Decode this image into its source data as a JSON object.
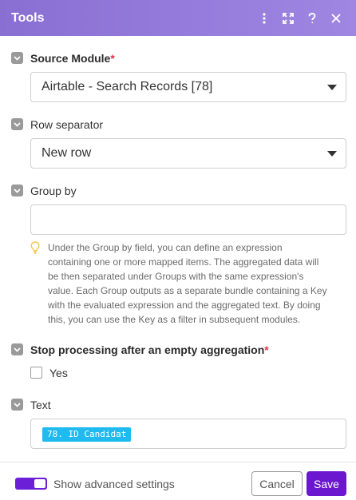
{
  "header": {
    "title": "Tools",
    "icons": [
      "more-vertical-icon",
      "expand-icon",
      "help-icon",
      "close-icon"
    ]
  },
  "fields": {
    "source_module": {
      "label": "Source Module",
      "required_mark": "*",
      "value": "Airtable - Search Records [78]"
    },
    "row_separator": {
      "label": "Row separator",
      "value": "New row"
    },
    "group_by": {
      "label": "Group by",
      "value": "",
      "hint_lines": [
        "Under the Group by field, you can define an expression",
        "containing one or more mapped items. The aggregated data will",
        "be then separated under Groups with the same expression's",
        "value. Each Group outputs as a separate bundle containing a Key",
        "with the evaluated expression and the aggregated text. By doing",
        "this, you can use the Key as a filter in subsequent modules."
      ]
    },
    "stop_processing": {
      "label": "Stop processing after an empty aggregation",
      "required_mark": "*",
      "checkbox_label": "Yes",
      "checked": false
    },
    "text": {
      "label": "Text",
      "pill": "78. ID Candidat"
    }
  },
  "footer": {
    "advanced_label": "Show advanced settings",
    "advanced_enabled": true,
    "cancel_label": "Cancel",
    "save_label": "Save"
  },
  "colors": {
    "header": "#8a6fd3",
    "required": "#e0334b",
    "pill": "#1fbaf0",
    "primary": "#6a17cf",
    "hint_icon": "#f2c94c"
  }
}
